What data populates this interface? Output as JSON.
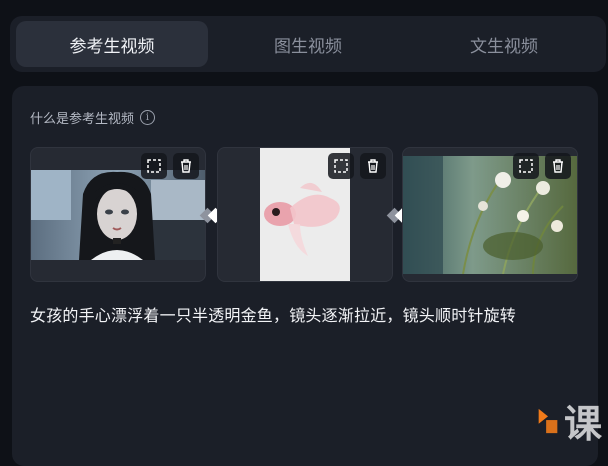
{
  "tabs": [
    {
      "label": "参考生视频",
      "active": true
    },
    {
      "label": "图生视频",
      "active": false
    },
    {
      "label": "文生视频",
      "active": false
    }
  ],
  "section": {
    "title": "什么是参考生视频",
    "info_glyph": "i"
  },
  "cards": [
    {
      "subject": "girl-portrait",
      "actions": [
        "crop-icon",
        "trash-icon"
      ]
    },
    {
      "subject": "goldfish",
      "actions": [
        "crop-icon",
        "trash-icon"
      ]
    },
    {
      "subject": "flowers-plants",
      "actions": [
        "crop-icon",
        "trash-icon"
      ]
    }
  ],
  "prompt": "女孩的手心漂浮着一只半透明金鱼，镜头逐渐拉近，镜头顺时针旋转",
  "watermark": {
    "text": "课"
  },
  "colors": {
    "bg": "#0e1117",
    "panel": "#1b1f28",
    "active_tab": "#2b303b",
    "accent": "#f07a1a"
  }
}
